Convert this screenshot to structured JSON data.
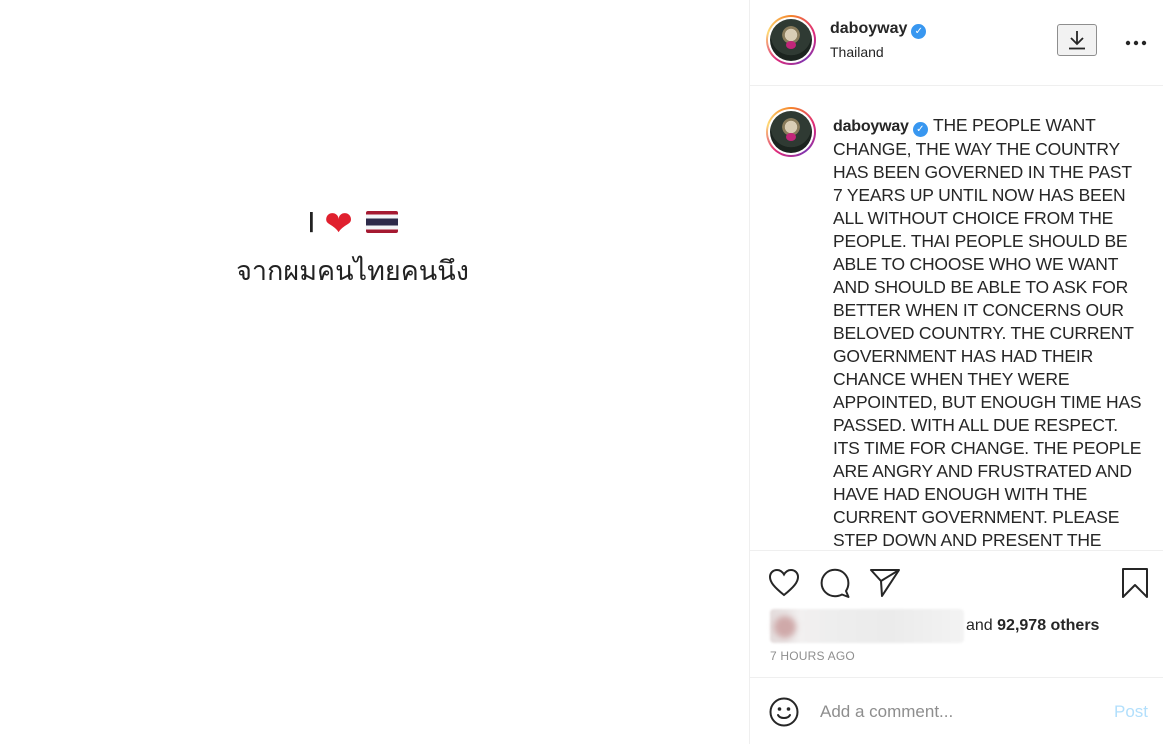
{
  "post_image": {
    "line1_prefix": "I",
    "line1_heart": "❤",
    "line2": "จากผมคนไทยคนนึง"
  },
  "header": {
    "username": "daboyway",
    "location": "Thailand",
    "verified_mark": "✓"
  },
  "caption": {
    "username": "daboyway",
    "text": "THE PEOPLE WANT CHANGE, THE WAY THE COUNTRY HAS BEEN GOVERNED IN THE PAST 7 YEARS UP UNTIL NOW HAS BEEN ALL WITHOUT CHOICE FROM THE PEOPLE. THAI PEOPLE SHOULD BE ABLE TO CHOOSE WHO WE WANT AND SHOULD BE ABLE TO ASK FOR BETTER WHEN IT CONCERNS OUR BELOVED COUNTRY. THE CURRENT GOVERNMENT HAS HAD THEIR CHANCE WHEN THEY WERE APPOINTED, BUT ENOUGH TIME HAS PASSED. WITH ALL DUE RESPECT. ITS TIME FOR CHANGE. THE PEOPLE ARE ANGRY AND FRUSTRATED AND HAVE HAD ENOUGH WITH THE CURRENT GOVERNMENT. PLEASE STEP DOWN AND PRESENT THE PEOPLE WITH OPTIONS THAT WILL BETTER"
  },
  "likes": {
    "prefix": "and",
    "count": "92,978 others"
  },
  "timestamp": "7 HOURS AGO",
  "comment": {
    "placeholder": "Add a comment...",
    "post_label": "Post"
  },
  "icons": {
    "download": "download-icon",
    "more": "more-options-icon",
    "like": "heart-icon",
    "comment": "comment-icon",
    "share": "share-icon",
    "save": "bookmark-icon",
    "emoji": "emoji-icon"
  },
  "colors": {
    "verified": "#3897f0",
    "post_button_disabled": "#b2dffc",
    "secondary_text": "#8e8e8e",
    "heart_emoji": "#e0202e"
  }
}
